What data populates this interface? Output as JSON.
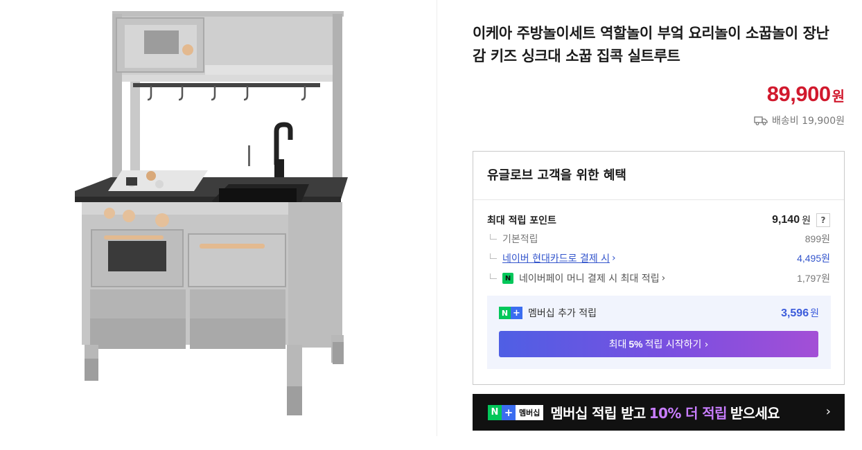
{
  "product": {
    "image_alt": "IKEA play kitchen",
    "title": "이케아 주방놀이세트 역할놀이 부엌 요리놀이 소꿉놀이 장난감 키즈 싱크대 소꿉 집콕 실트루트",
    "price": "89,900",
    "price_unit": "원",
    "shipping": "배송비 19,900원"
  },
  "benefits": {
    "title": "유글로브 고객을 위한 혜택",
    "max_points_label": "최대 적립 포인트",
    "max_points_value": "9,140",
    "max_points_unit": "원",
    "help_label": "?",
    "rows": [
      {
        "label": "기본적립",
        "value": "899원"
      },
      {
        "label": "네이버 현대카드로 결제 시",
        "value": "4,495원"
      },
      {
        "label": "네이버페이 머니 결제 시 최대 적립",
        "value": "1,797원"
      }
    ],
    "npay_icon_text": "N",
    "membership": {
      "badge_n": "N",
      "badge_plus": "+",
      "label": "멤버십 추가 적립",
      "value": "3,596",
      "unit": "원",
      "button_pre": "최대",
      "button_percent": "5%",
      "button_post": "적립 시작하기 ›"
    }
  },
  "promo": {
    "badge_n": "N",
    "badge_plus": "+",
    "badge_tag": "멤버십",
    "text_pre": "멤버십 적립 받고",
    "text_highlight": "10% 더 적립",
    "text_post": "받으세요",
    "arrow": "›"
  },
  "colors": {
    "price": "#d1192d",
    "link": "#3355cc",
    "membership_value": "#3b5bdb",
    "naver_green": "#03c75a",
    "plus_blue": "#3b6df0",
    "promo_highlight": "#c87dff"
  },
  "icons": {
    "truck": "truck-icon",
    "chevron": "chevron-right-icon",
    "help": "question-icon"
  }
}
